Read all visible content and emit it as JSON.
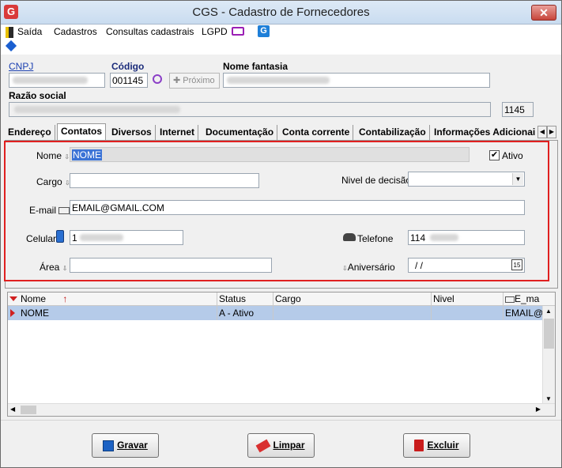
{
  "window": {
    "title": "CGS - Cadastro de Fornecedores",
    "close_label": "✕"
  },
  "menu": [
    "Saída",
    "Cadastros",
    "Consultas cadastrais",
    "LGPD"
  ],
  "header": {
    "cnpj_label": "CNPJ",
    "codigo_label": "Código",
    "codigo_value": "001145",
    "proximo_label": "Próximo",
    "nome_fantasia_label": "Nome fantasia",
    "razao_social_label": "Razão social",
    "code_right_value": "1145"
  },
  "tabs": [
    "Endereço",
    "Contatos",
    "Diversos",
    "Internet",
    "Documentação",
    "Conta corrente",
    "Contabilização",
    "Informações Adicionai"
  ],
  "contact_form": {
    "nome_label": "Nome",
    "nome_value": "NOME",
    "ativo_label": "Ativo",
    "ativo_checked": "✔",
    "cargo_label": "Cargo",
    "nivel_label": "Nivel de decisão",
    "email_label": "E-mail",
    "email_value": "EMAIL@GMAIL.COM",
    "celular_label": "Celular",
    "celular_prefix": "1",
    "telefone_label": "Telefone",
    "telefone_prefix": "114",
    "area_label": "Área",
    "aniversario_label": "Aniversário",
    "aniversario_value": "/  /"
  },
  "grid": {
    "columns": [
      "Nome",
      "Status",
      "Cargo",
      "Nivel",
      "E_ma"
    ],
    "rows": [
      {
        "nome": "NOME",
        "status": "A - Ativo",
        "cargo": "",
        "nivel": "",
        "email": "EMAIL@G"
      }
    ]
  },
  "buttons": {
    "gravar": "Gravar",
    "limpar": "Limpar",
    "excluir": "Excluir"
  }
}
